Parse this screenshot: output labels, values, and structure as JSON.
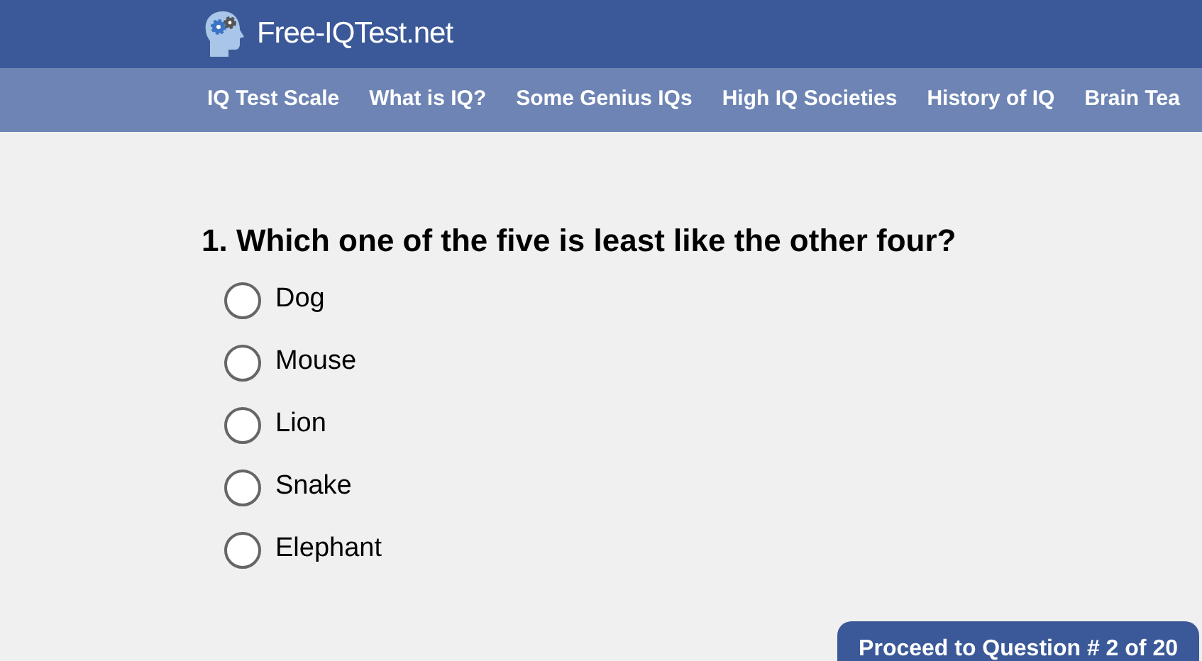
{
  "header": {
    "site_title": "Free-IQTest.net"
  },
  "nav": [
    "IQ Test Scale",
    "What is IQ?",
    "Some Genius IQs",
    "High IQ Societies",
    "History of IQ",
    "Brain Tea"
  ],
  "question": {
    "text": "1. Which one of the five is least like the other four?",
    "options": [
      {
        "label": "Dog",
        "selected": false
      },
      {
        "label": "Mouse",
        "selected": false
      },
      {
        "label": "Lion",
        "selected": false
      },
      {
        "label": "Snake",
        "selected": false
      },
      {
        "label": "Elephant",
        "selected": false
      }
    ]
  },
  "proceed_button": "Proceed to Question # 2 of 20"
}
